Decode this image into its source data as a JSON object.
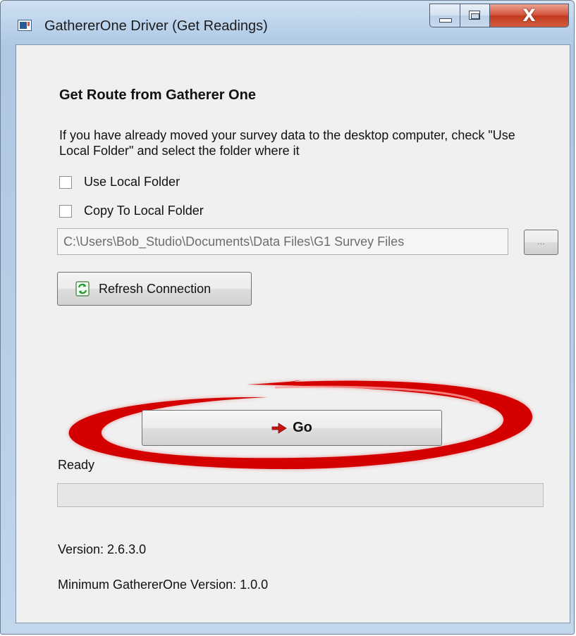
{
  "window": {
    "title": "GathererOne Driver (Get Readings)",
    "controls": {
      "close_label": "X"
    }
  },
  "form": {
    "heading": "Get Route from Gatherer One",
    "instructions": "If you have already moved your survey data to the desktop computer, check \"Use Local Folder\" and select the folder where it",
    "use_local_folder": {
      "label": "Use Local Folder",
      "checked": false
    },
    "copy_to_local_folder": {
      "label": "Copy To Local Folder",
      "checked": false
    },
    "folder_path": {
      "value": "C:\\Users\\Bob_Studio\\Documents\\Data Files\\G1 Survey Files",
      "enabled": false
    },
    "browse_button": {
      "label": "..."
    },
    "refresh_button": {
      "label": "Refresh Connection",
      "icon": "refresh-icon"
    },
    "go_button": {
      "label": "Go",
      "icon": "red-arrow-icon"
    }
  },
  "status": {
    "text": "Ready",
    "progress": 0
  },
  "footer": {
    "version": "Version: 2.6.3.0",
    "min_version": "Minimum GathererOne Version: 1.0.0"
  },
  "colors": {
    "highlight_ring": "#d40000",
    "go_arrow": "#cc1111",
    "refresh_icon": "#1e9a2e",
    "close_button": "#c2391d"
  }
}
